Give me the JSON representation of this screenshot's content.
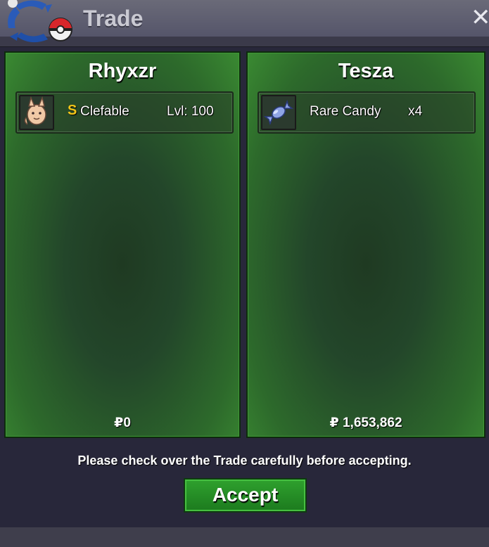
{
  "window": {
    "title": "Trade",
    "close_label": "✕"
  },
  "left_panel": {
    "name": "Rhyxzr",
    "item": {
      "icon": "clefable-sprite-icon",
      "shiny_mark": "S",
      "name": "Clefable",
      "detail": "Lvl: 100"
    },
    "money": "₽0"
  },
  "right_panel": {
    "name": "Tesza",
    "item": {
      "icon": "rare-candy-icon",
      "name": "Rare Candy",
      "detail": "x4"
    },
    "money": "₽ 1,653,862"
  },
  "footer": {
    "notice": "Please check over the Trade carefully before accepting.",
    "accept_label": "Accept"
  },
  "colors": {
    "panel_green": "#2d6a2b",
    "button_green": "#2fa12e",
    "shiny_gold": "#f2c418"
  }
}
